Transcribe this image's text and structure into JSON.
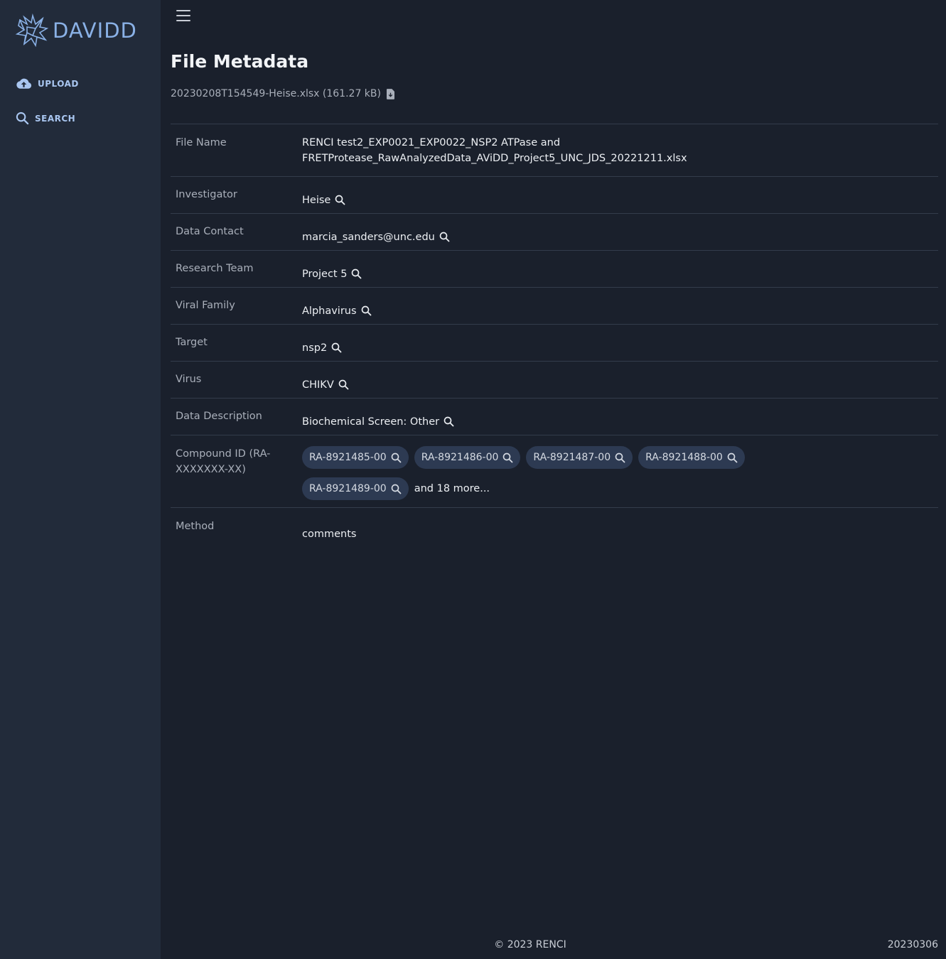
{
  "app": {
    "logo_text": "DAVIDD"
  },
  "sidebar": {
    "items": [
      {
        "label": "UPLOAD",
        "icon": "cloud-upload-icon"
      },
      {
        "label": "SEARCH",
        "icon": "search-icon"
      }
    ]
  },
  "page": {
    "title": "File Metadata",
    "file_label": "20230208T154549-Heise.xlsx (161.27 kB)"
  },
  "metadata": {
    "file_name": {
      "label": "File Name",
      "value_line1": "RENCI test2_EXP0021_EXP0022_NSP2 ATPase and",
      "value_line2": "FRETProtease_RawAnalyzedData_AViDD_Project5_UNC_JDS_20221211.xlsx"
    },
    "investigator": {
      "label": "Investigator",
      "value": "Heise"
    },
    "data_contact": {
      "label": "Data Contact",
      "value": "marcia_sanders@unc.edu"
    },
    "research_team": {
      "label": "Research Team",
      "value": "Project 5"
    },
    "viral_family": {
      "label": "Viral Family",
      "value": "Alphavirus"
    },
    "target": {
      "label": "Target",
      "value": "nsp2"
    },
    "virus": {
      "label": "Virus",
      "value": "CHIKV"
    },
    "data_description": {
      "label": "Data Description",
      "value": "Biochemical Screen: Other"
    },
    "compound_id": {
      "label_line1": "Compound ID (RA-",
      "label_line2": "XXXXXXX-XX)",
      "chips": [
        "RA-8921485-00",
        "RA-8921486-00",
        "RA-8921487-00",
        "RA-8921488-00",
        "RA-8921489-00"
      ],
      "more": "and 18 more..."
    },
    "method": {
      "label": "Method",
      "value": "comments"
    }
  },
  "footer": {
    "copyright": "© 2023 RENCI",
    "version": "20230306"
  },
  "colors": {
    "background": "#1a202c",
    "sidebar": "#222b3a",
    "accent": "#8ab1e6",
    "chip": "#2d3a52"
  }
}
